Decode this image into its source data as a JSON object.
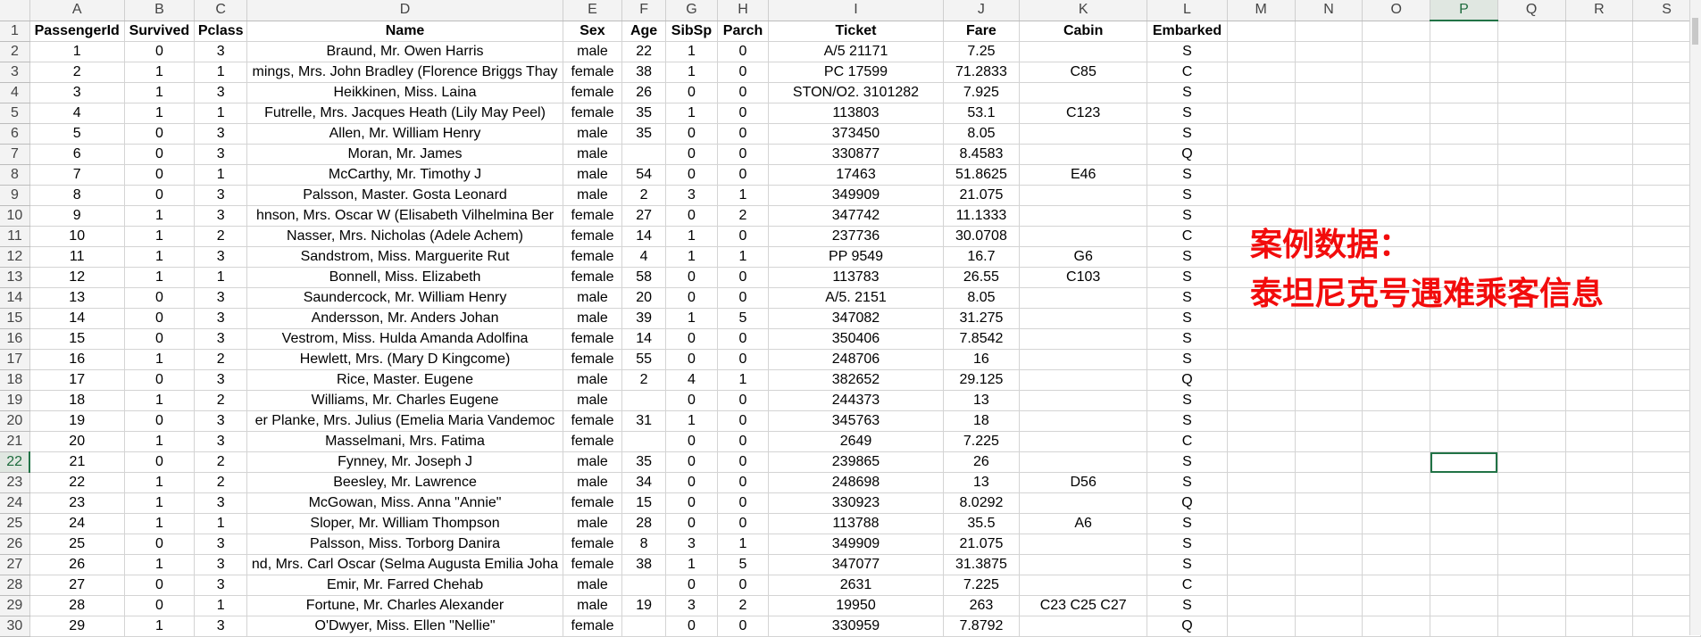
{
  "columns": [
    "A",
    "B",
    "C",
    "D",
    "E",
    "F",
    "G",
    "H",
    "I",
    "J",
    "K",
    "L",
    "M",
    "N",
    "O",
    "P",
    "Q",
    "R",
    "S"
  ],
  "selected_column": "P",
  "selected_row": "22",
  "rows": [
    {
      "num": "1",
      "cells": [
        "PassengerId",
        "Survived",
        "Pclass",
        "Name",
        "Sex",
        "Age",
        "SibSp",
        "Parch",
        "Ticket",
        "Fare",
        "Cabin",
        "Embarked"
      ]
    },
    {
      "num": "2",
      "cells": [
        "1",
        "0",
        "3",
        "Braund, Mr. Owen Harris",
        "male",
        "22",
        "1",
        "0",
        "A/5 21171",
        "7.25",
        "",
        "S"
      ]
    },
    {
      "num": "3",
      "cells": [
        "2",
        "1",
        "1",
        "mings, Mrs. John Bradley (Florence Briggs Thay",
        "female",
        "38",
        "1",
        "0",
        "PC 17599",
        "71.2833",
        "C85",
        "C"
      ]
    },
    {
      "num": "4",
      "cells": [
        "3",
        "1",
        "3",
        "Heikkinen, Miss. Laina",
        "female",
        "26",
        "0",
        "0",
        "STON/O2. 3101282",
        "7.925",
        "",
        "S"
      ]
    },
    {
      "num": "5",
      "cells": [
        "4",
        "1",
        "1",
        "Futrelle, Mrs. Jacques Heath (Lily May Peel)",
        "female",
        "35",
        "1",
        "0",
        "113803",
        "53.1",
        "C123",
        "S"
      ]
    },
    {
      "num": "6",
      "cells": [
        "5",
        "0",
        "3",
        "Allen, Mr. William Henry",
        "male",
        "35",
        "0",
        "0",
        "373450",
        "8.05",
        "",
        "S"
      ]
    },
    {
      "num": "7",
      "cells": [
        "6",
        "0",
        "3",
        "Moran, Mr. James",
        "male",
        "",
        "0",
        "0",
        "330877",
        "8.4583",
        "",
        "Q"
      ]
    },
    {
      "num": "8",
      "cells": [
        "7",
        "0",
        "1",
        "McCarthy, Mr. Timothy J",
        "male",
        "54",
        "0",
        "0",
        "17463",
        "51.8625",
        "E46",
        "S"
      ]
    },
    {
      "num": "9",
      "cells": [
        "8",
        "0",
        "3",
        "Palsson, Master. Gosta Leonard",
        "male",
        "2",
        "3",
        "1",
        "349909",
        "21.075",
        "",
        "S"
      ]
    },
    {
      "num": "10",
      "cells": [
        "9",
        "1",
        "3",
        "hnson, Mrs. Oscar W (Elisabeth Vilhelmina Ber",
        "female",
        "27",
        "0",
        "2",
        "347742",
        "11.1333",
        "",
        "S"
      ]
    },
    {
      "num": "11",
      "cells": [
        "10",
        "1",
        "2",
        "Nasser, Mrs. Nicholas (Adele Achem)",
        "female",
        "14",
        "1",
        "0",
        "237736",
        "30.0708",
        "",
        "C"
      ]
    },
    {
      "num": "12",
      "cells": [
        "11",
        "1",
        "3",
        "Sandstrom, Miss. Marguerite Rut",
        "female",
        "4",
        "1",
        "1",
        "PP 9549",
        "16.7",
        "G6",
        "S"
      ]
    },
    {
      "num": "13",
      "cells": [
        "12",
        "1",
        "1",
        "Bonnell, Miss. Elizabeth",
        "female",
        "58",
        "0",
        "0",
        "113783",
        "26.55",
        "C103",
        "S"
      ]
    },
    {
      "num": "14",
      "cells": [
        "13",
        "0",
        "3",
        "Saundercock, Mr. William Henry",
        "male",
        "20",
        "0",
        "0",
        "A/5. 2151",
        "8.05",
        "",
        "S"
      ]
    },
    {
      "num": "15",
      "cells": [
        "14",
        "0",
        "3",
        "Andersson, Mr. Anders Johan",
        "male",
        "39",
        "1",
        "5",
        "347082",
        "31.275",
        "",
        "S"
      ]
    },
    {
      "num": "16",
      "cells": [
        "15",
        "0",
        "3",
        "Vestrom, Miss. Hulda Amanda Adolfina",
        "female",
        "14",
        "0",
        "0",
        "350406",
        "7.8542",
        "",
        "S"
      ]
    },
    {
      "num": "17",
      "cells": [
        "16",
        "1",
        "2",
        "Hewlett, Mrs. (Mary D Kingcome)",
        "female",
        "55",
        "0",
        "0",
        "248706",
        "16",
        "",
        "S"
      ]
    },
    {
      "num": "18",
      "cells": [
        "17",
        "0",
        "3",
        "Rice, Master. Eugene",
        "male",
        "2",
        "4",
        "1",
        "382652",
        "29.125",
        "",
        "Q"
      ]
    },
    {
      "num": "19",
      "cells": [
        "18",
        "1",
        "2",
        "Williams, Mr. Charles Eugene",
        "male",
        "",
        "0",
        "0",
        "244373",
        "13",
        "",
        "S"
      ]
    },
    {
      "num": "20",
      "cells": [
        "19",
        "0",
        "3",
        "er Planke, Mrs. Julius (Emelia Maria Vandemoc",
        "female",
        "31",
        "1",
        "0",
        "345763",
        "18",
        "",
        "S"
      ]
    },
    {
      "num": "21",
      "cells": [
        "20",
        "1",
        "3",
        "Masselmani, Mrs. Fatima",
        "female",
        "",
        "0",
        "0",
        "2649",
        "7.225",
        "",
        "C"
      ]
    },
    {
      "num": "22",
      "cells": [
        "21",
        "0",
        "2",
        "Fynney, Mr. Joseph J",
        "male",
        "35",
        "0",
        "0",
        "239865",
        "26",
        "",
        "S"
      ]
    },
    {
      "num": "23",
      "cells": [
        "22",
        "1",
        "2",
        "Beesley, Mr. Lawrence",
        "male",
        "34",
        "0",
        "0",
        "248698",
        "13",
        "D56",
        "S"
      ]
    },
    {
      "num": "24",
      "cells": [
        "23",
        "1",
        "3",
        "McGowan, Miss. Anna \"Annie\"",
        "female",
        "15",
        "0",
        "0",
        "330923",
        "8.0292",
        "",
        "Q"
      ]
    },
    {
      "num": "25",
      "cells": [
        "24",
        "1",
        "1",
        "Sloper, Mr. William Thompson",
        "male",
        "28",
        "0",
        "0",
        "113788",
        "35.5",
        "A6",
        "S"
      ]
    },
    {
      "num": "26",
      "cells": [
        "25",
        "0",
        "3",
        "Palsson, Miss. Torborg Danira",
        "female",
        "8",
        "3",
        "1",
        "349909",
        "21.075",
        "",
        "S"
      ]
    },
    {
      "num": "27",
      "cells": [
        "26",
        "1",
        "3",
        "nd, Mrs. Carl Oscar (Selma Augusta Emilia Joha",
        "female",
        "38",
        "1",
        "5",
        "347077",
        "31.3875",
        "",
        "S"
      ]
    },
    {
      "num": "28",
      "cells": [
        "27",
        "0",
        "3",
        "Emir, Mr. Farred Chehab",
        "male",
        "",
        "0",
        "0",
        "2631",
        "7.225",
        "",
        "C"
      ]
    },
    {
      "num": "29",
      "cells": [
        "28",
        "0",
        "1",
        "Fortune, Mr. Charles Alexander",
        "male",
        "19",
        "3",
        "2",
        "19950",
        "263",
        "C23 C25 C27",
        "S"
      ]
    },
    {
      "num": "30",
      "cells": [
        "29",
        "1",
        "3",
        "O'Dwyer, Miss. Ellen \"Nellie\"",
        "female",
        "",
        "0",
        "0",
        "330959",
        "7.8792",
        "",
        "Q"
      ]
    }
  ],
  "overlay": {
    "line1": "案例数据：",
    "line2": "泰坦尼克号遇难乘客信息"
  },
  "colors": {
    "overlay_text": "#f20c0c",
    "selection": "#217346",
    "header_bg": "#f3f3f3",
    "gridline": "#d4d4d4"
  }
}
